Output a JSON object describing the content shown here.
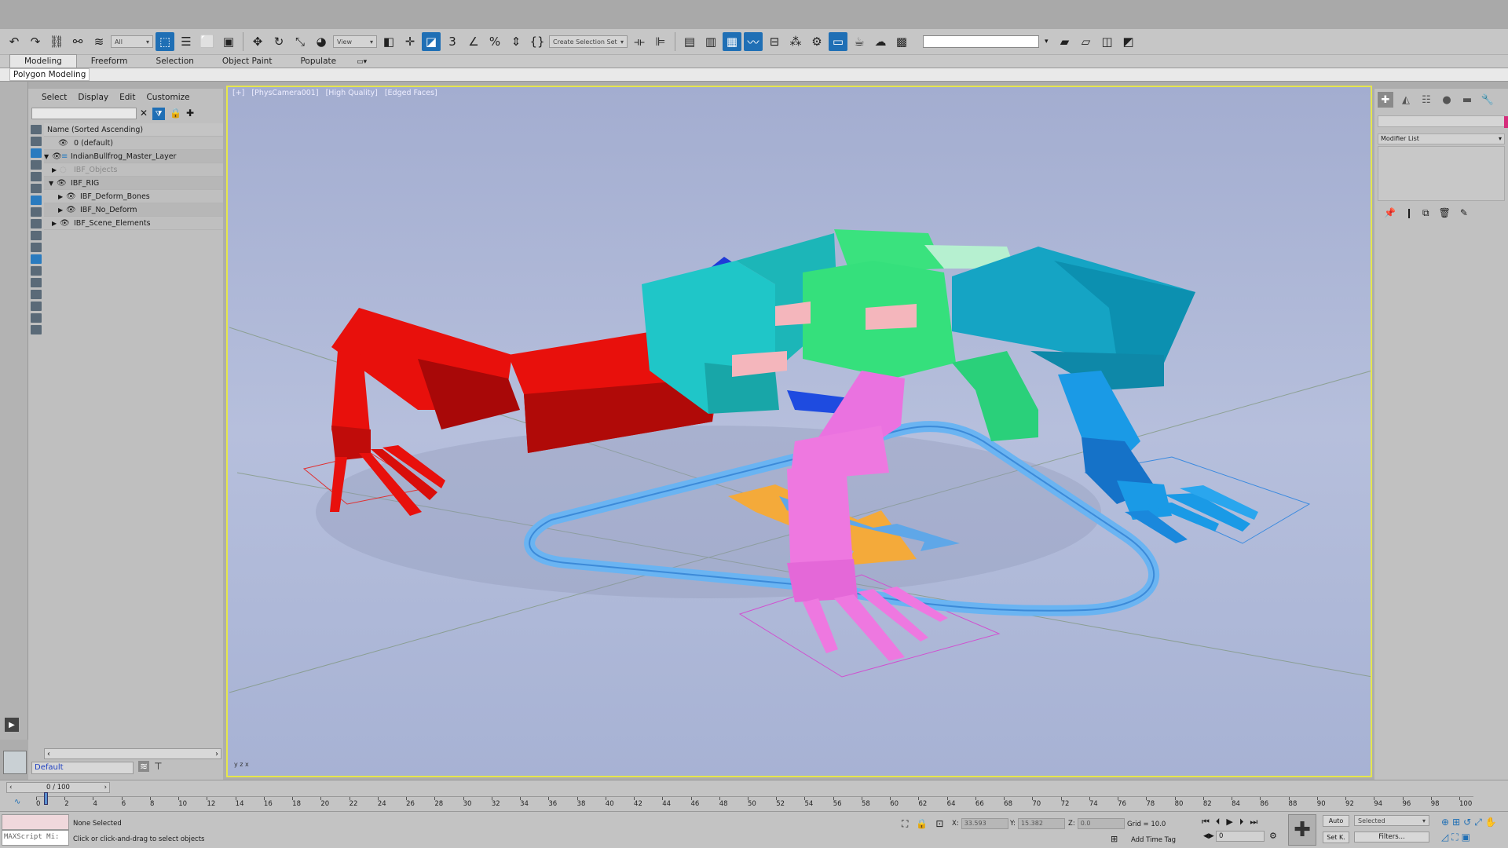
{
  "toolbar": {
    "filter_selection": "All",
    "view_dropdown": "View",
    "selection_set": "Create Selection Set",
    "search_value": ""
  },
  "ribbon": {
    "tabs": [
      "Modeling",
      "Freeform",
      "Selection",
      "Object Paint",
      "Populate"
    ],
    "active_tab": "Modeling",
    "panel_label": "Polygon Modeling"
  },
  "explorer": {
    "menu": [
      "Select",
      "Display",
      "Edit",
      "Customize"
    ],
    "column_header": "Name (Sorted Ascending)",
    "rows": [
      {
        "label": "0 (default)",
        "dim": false
      },
      {
        "label": "IndianBullfrog_Master_Layer",
        "dim": false
      },
      {
        "label": "IBF_Objects",
        "dim": true
      },
      {
        "label": "IBF_RIG",
        "dim": false
      },
      {
        "label": "IBF_Deform_Bones",
        "dim": false
      },
      {
        "label": "IBF_No_Deform",
        "dim": false
      },
      {
        "label": "IBF_Scene_Elements",
        "dim": false
      }
    ],
    "layer_field": "Default"
  },
  "viewport": {
    "label_parts": [
      "[+]",
      "[PhysCamera001]",
      "[High Quality]",
      "[Edged Faces]"
    ],
    "axis_label": "y z x"
  },
  "command_panel": {
    "modifier_list": "Modifier List",
    "object_color": "#d52e7c"
  },
  "timeline": {
    "frame_readout": "0 / 100",
    "ticks": [
      "0",
      "2",
      "4",
      "6",
      "8",
      "10",
      "12",
      "14",
      "16",
      "18",
      "20",
      "22",
      "24",
      "26",
      "28",
      "30",
      "32",
      "34",
      "36",
      "38",
      "40",
      "42",
      "44",
      "46",
      "48",
      "50",
      "52",
      "54",
      "56",
      "58",
      "60",
      "62",
      "64",
      "66",
      "68",
      "70",
      "72",
      "74",
      "76",
      "78",
      "80",
      "82",
      "84",
      "86",
      "88",
      "90",
      "92",
      "94",
      "96",
      "98",
      "100"
    ]
  },
  "status": {
    "maxscript_placeholder": "MAXScript Mi:",
    "selection_status": "None Selected",
    "prompt": "Click or click-and-drag to select objects",
    "x_label": "X:",
    "x_value": "33.593",
    "y_label": "Y:",
    "y_value": "15.382",
    "z_label": "Z:",
    "z_value": "0.0",
    "grid": "Grid = 10.0",
    "add_time_tag": "Add Time Tag",
    "frame_value": "0",
    "auto_key": "Auto",
    "set_key": "Set K.",
    "selected_dd": "Selected",
    "filters": "Filters..."
  },
  "colors": {
    "accent": "#1f6fb5",
    "viewport_border": "#e6e64c",
    "red_leg": "#e8100c",
    "cyan_body": "#1fc6c8",
    "green_body": "#35e07c",
    "pink_leg": "#ee78e0",
    "blue_leg": "#1a9ae6",
    "control_ring": "#6ab4f2",
    "arrow_orange": "#f4aa3a"
  }
}
